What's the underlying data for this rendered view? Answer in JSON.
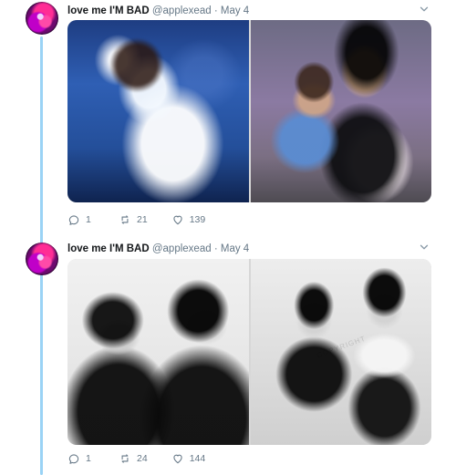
{
  "theme": {
    "thread_line": "#9ad3f5",
    "name": "#14171a",
    "muted": "#657786",
    "border": "#e6ecf0"
  },
  "tweets": [
    {
      "display_name": "love me I'M BAD",
      "handle": "@applexead",
      "separator": "·",
      "date": "May 4",
      "avatar_icon": "avatar-icon",
      "menu_icon": "chevron-down-icon",
      "media": [
        {
          "label": ""
        },
        {
          "label": ""
        }
      ],
      "actions": {
        "reply": {
          "icon": "reply-icon",
          "count": "1"
        },
        "retweet": {
          "icon": "retweet-icon",
          "count": "21"
        },
        "like": {
          "icon": "heart-icon",
          "count": "139"
        }
      }
    },
    {
      "display_name": "love me I'M BAD",
      "handle": "@applexead",
      "separator": "·",
      "date": "May 4",
      "avatar_icon": "avatar-icon",
      "menu_icon": "chevron-down-icon",
      "media": [
        {
          "label": ""
        },
        {
          "label": ""
        }
      ],
      "actions": {
        "reply": {
          "icon": "reply-icon",
          "count": "1"
        },
        "retweet": {
          "icon": "retweet-icon",
          "count": "24"
        },
        "like": {
          "icon": "heart-icon",
          "count": "144"
        }
      }
    }
  ]
}
